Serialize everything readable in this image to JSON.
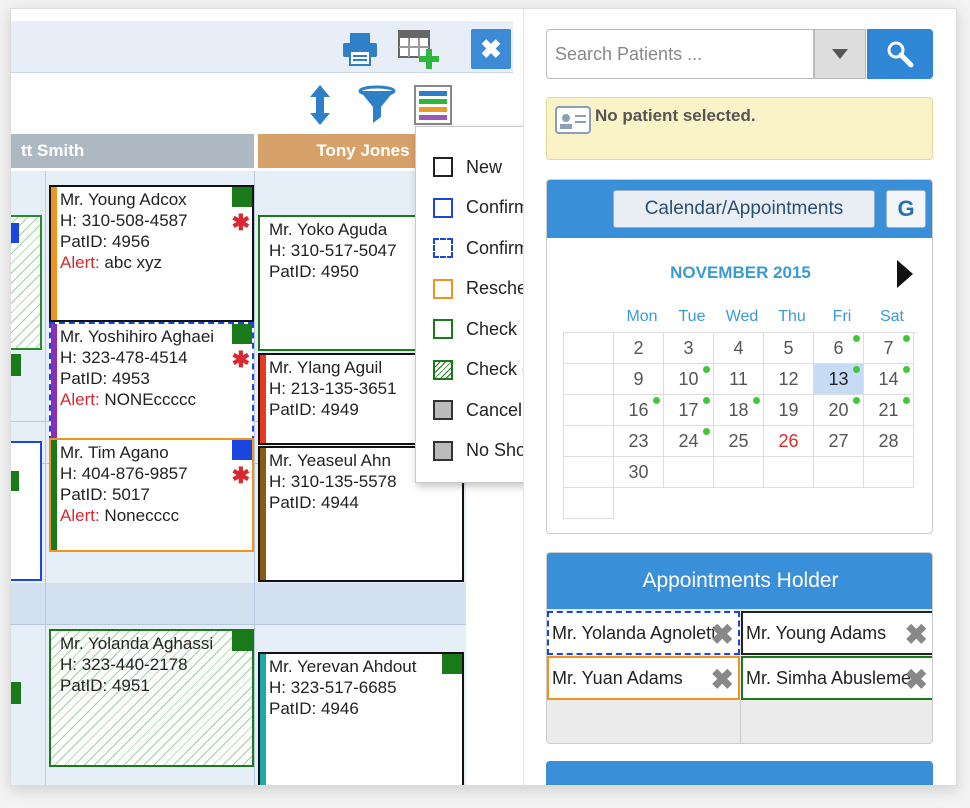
{
  "toolbar": {
    "icons": [
      "print-icon",
      "add-grid-icon",
      "close-icon",
      "sort-icon",
      "filter-icon",
      "legend-icon"
    ],
    "close_label": "✖"
  },
  "columns": [
    {
      "name": "tt Smith",
      "color": "#aeb8c2"
    },
    {
      "name": "Tony Jones",
      "color": "#d7a26a"
    }
  ],
  "appointments": [
    {
      "name": "Mr. Young Adcox",
      "phone": "H: 310-508-4587",
      "patid": "PatID: 4956",
      "alert_label": "Alert:",
      "alert": "abc xyz"
    },
    {
      "name": "Mr. Yoshihiro Aghaei",
      "phone": "H: 323-478-4514",
      "patid": "PatID: 4953",
      "alert_label": "Alert:",
      "alert": "NONEccccc"
    },
    {
      "name": "Mr. Tim Agano",
      "phone": "H: 404-876-9857",
      "patid": "PatID: 5017",
      "alert_label": "Alert:",
      "alert": "Nonecccc"
    },
    {
      "name": "Mr. Yolanda Aghassi",
      "phone": "H: 323-440-2178",
      "patid": "PatID: 4951"
    },
    {
      "name": "Mr. Yoko Aguda",
      "phone": "H: 310-517-5047",
      "patid": "PatID: 4950"
    },
    {
      "name": "Mr. Ylang Aguil",
      "phone": "H: 213-135-3651",
      "patid": "PatID: 4949"
    },
    {
      "name": "Mr. Yeaseul Ahn",
      "phone": "H: 310-135-5578",
      "patid": "PatID: 4944"
    },
    {
      "name": "Mr. Yerevan Ahdout",
      "phone": "H: 323-517-6685",
      "patid": "PatID: 4946"
    }
  ],
  "status_menu": [
    "New",
    "Confirmed",
    "Confirm Hold",
    "Rescheduled",
    "Check in",
    "Check out",
    "Cancel",
    "No Show"
  ],
  "search": {
    "placeholder": "Search Patients ..."
  },
  "patient": {
    "message": "No patient selected."
  },
  "calendar": {
    "button": "Calendar/Appointments",
    "g_button": "G",
    "month": "NOVEMBER 2015",
    "days": [
      "Mon",
      "Tue",
      "Wed",
      "Thu",
      "Fri",
      "Sat"
    ],
    "weeks": [
      [
        "2",
        "3",
        "4",
        "5",
        "6",
        "7"
      ],
      [
        "9",
        "10",
        "11",
        "12",
        "13",
        "14"
      ],
      [
        "16",
        "17",
        "18",
        "19",
        "20",
        "21"
      ],
      [
        "23",
        "24",
        "25",
        "26",
        "27",
        "28"
      ],
      [
        "30",
        "",
        "",
        "",
        "",
        ""
      ]
    ]
  },
  "holder": {
    "title": "Appointments Holder",
    "items": [
      "Mr. Yolanda Agnoletti",
      "Mr. Young Adams",
      "Mr. Yuan Adams",
      "Mr. Simha Abusleme"
    ]
  }
}
